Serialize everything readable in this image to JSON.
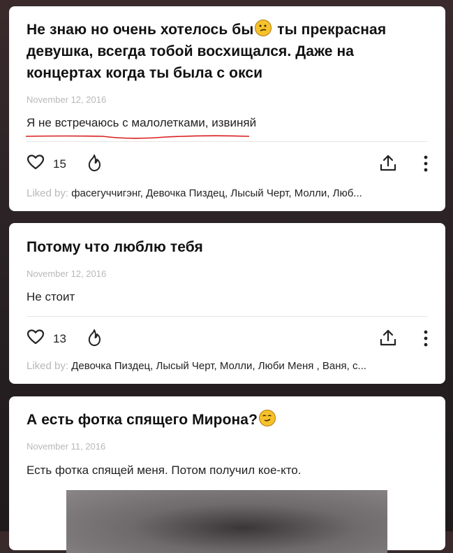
{
  "cards": [
    {
      "question_before": "Не знаю но очень хотелось бы",
      "question_emoji": "confused-face",
      "question_after": " ты прекрасная девушка, всегда тобой восхищался. Даже на концертах когда ты была с окси",
      "date": "November 12, 2016",
      "answer": "Я не встречаюсь с малолетками, извиняй",
      "likes": "15",
      "liked_label": "Liked by:",
      "liked_names": "фасегуччигэнг, Девочка Пиздец, Лысый Черт, Молли, Люб..."
    },
    {
      "question_before": "Потому что люблю тебя",
      "date": "November 12, 2016",
      "answer": "Не стоит",
      "likes": "13",
      "liked_label": "Liked by:",
      "liked_names": "Девочка Пиздец, Лысый Черт, Молли, Люби Меня , Ваня, с..."
    },
    {
      "question_before": "А есть фотка спящего Мирона?",
      "question_emoji": "smirking-face",
      "date": "November 11, 2016",
      "answer": "Есть фотка спящей меня. Потом получил кое-кто."
    }
  ],
  "colors": {
    "accent_underline": "#d81e1e",
    "emoji_yellow": "#f7c12b"
  },
  "icons": [
    "heart-icon",
    "fire-icon",
    "share-icon",
    "more-icon"
  ]
}
